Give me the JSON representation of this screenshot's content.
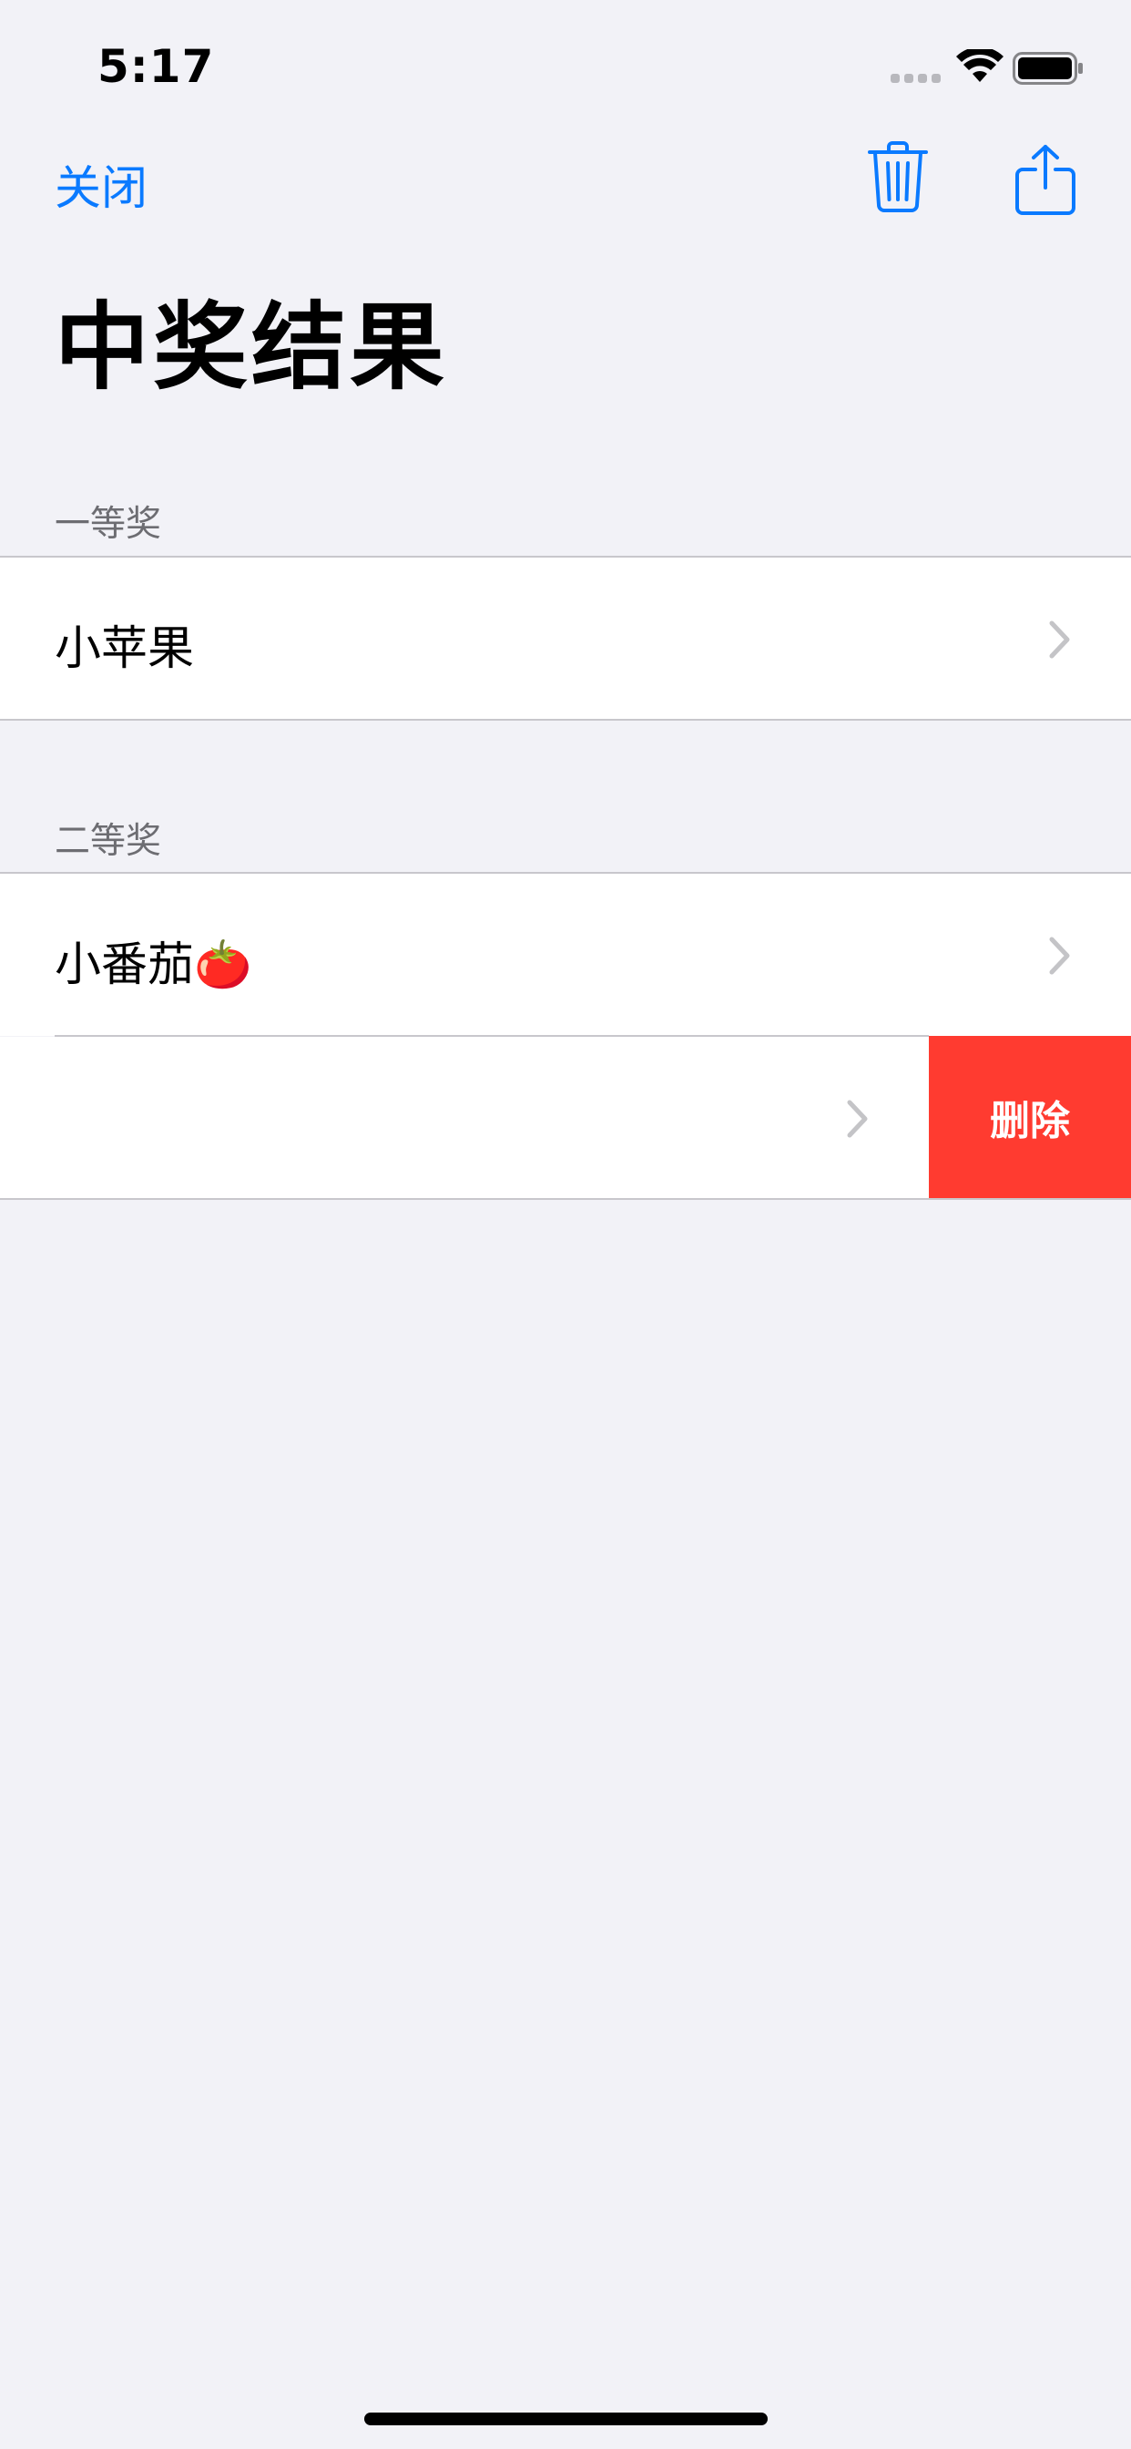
{
  "status_bar": {
    "time": "5:17"
  },
  "nav": {
    "close_label": "关闭"
  },
  "title": "中奖结果",
  "sections": [
    {
      "header": "一等奖",
      "rows": [
        {
          "label": "小苹果"
        }
      ]
    },
    {
      "header": "二等奖",
      "rows": [
        {
          "label": "小番茄🍅"
        },
        {
          "label": ""
        }
      ]
    }
  ],
  "swipe_action": {
    "label": "删除",
    "color": "#ff3b30"
  },
  "colors": {
    "accent": "#0a7aff",
    "background": "#f2f2f7",
    "separator": "#c8c7cc"
  },
  "icons": [
    "trash-icon",
    "share-icon",
    "chevron-right-icon",
    "wifi-icon",
    "battery-icon"
  ]
}
